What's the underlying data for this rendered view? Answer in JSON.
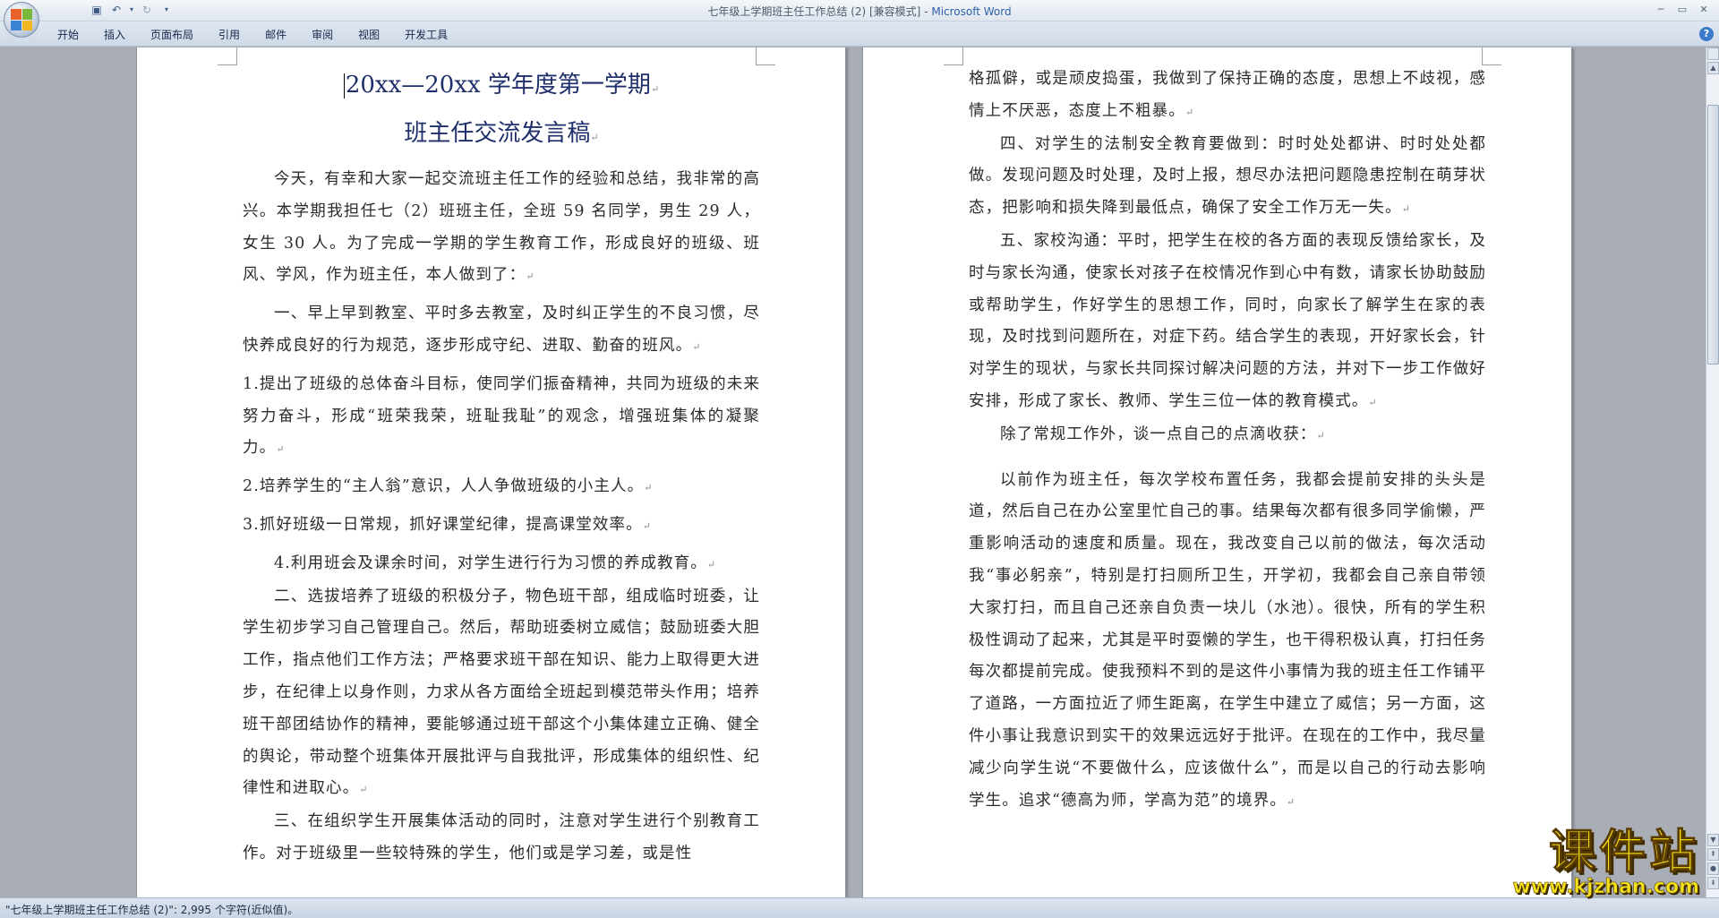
{
  "window": {
    "title": "七年级上学期班主任工作总结 (2) [兼容模式]",
    "title_separator": " - ",
    "app_name": "Microsoft Word"
  },
  "qat": {
    "save_icon": "save-icon",
    "undo_icon": "undo-icon",
    "redo_icon": "redo-icon",
    "customize_icon": "dropdown-icon"
  },
  "ribbon": {
    "tabs": [
      "开始",
      "插入",
      "页面布局",
      "引用",
      "邮件",
      "审阅",
      "视图",
      "开发工具"
    ]
  },
  "document": {
    "title_line1": "20xx—20xx 学年度第一学期",
    "title_line2": "班主任交流发言稿",
    "para_mark": "↵",
    "left_paragraphs": [
      "今天，有幸和大家一起交流班主任工作的经验和总结，我非常的高兴。本学期我担任七（2）班班主任，全班 59 名同学，男生 29 人，女生 30 人。为了完成一学期的学生教育工作，形成良好的班级、班风、学风，作为班主任，本人做到了：",
      "一、早上早到教室、平时多去教室，及时纠正学生的不良习惯，尽快养成良好的行为规范，逐步形成守纪、进取、勤奋的班风。",
      "1.提出了班级的总体奋斗目标，使同学们振奋精神，共同为班级的未来努力奋斗，形成“班荣我荣，班耻我耻”的观念，增强班集体的凝聚力。",
      "2.培养学生的“主人翁”意识，人人争做班级的小主人。",
      "3.抓好班级一日常规，抓好课堂纪律，提高课堂效率。",
      "4.利用班会及课余时间，对学生进行行为习惯的养成教育。",
      "二、选拔培养了班级的积极分子，物色班干部，组成临时班委，让学生初步学习自己管理自己。然后，帮助班委树立威信；鼓励班委大胆工作，指点他们工作方法；严格要求班干部在知识、能力上取得更大进步，在纪律上以身作则，力求从各方面给全班起到模范带头作用；培养班干部团结协作的精神，要能够通过班干部这个小集体建立正确、健全的舆论，带动整个班集体开展批评与自我批评，形成集体的组织性、纪律性和进取心。",
      "三、在组织学生开展集体活动的同时，注意对学生进行个别教育工作。对于班级里一些较特殊的学生，他们或是学习差，或是性"
    ],
    "right_paragraphs": [
      "格孤僻，或是顽皮捣蛋，我做到了保持正确的态度，思想上不歧视，感情上不厌恶，态度上不粗暴。",
      "四、对学生的法制安全教育要做到：时时处处都讲、时时处处都做。发现问题及时处理，及时上报，想尽办法把问题隐患控制在萌芽状态，把影响和损失降到最低点，确保了安全工作万无一失。",
      "五、家校沟通：平时，把学生在校的各方面的表现反馈给家长，及时与家长沟通，使家长对孩子在校情况作到心中有数，请家长协助鼓励或帮助学生，作好学生的思想工作，同时，向家长了解学生在家的表现，及时找到问题所在，对症下药。结合学生的表现，开好家长会，针对学生的现状，与家长共同探讨解决问题的方法，并对下一步工作做好安排，形成了家长、教师、学生三位一体的教育模式。",
      "除了常规工作外，谈一点自己的点滴收获：",
      "以前作为班主任，每次学校布置任务，我都会提前安排的头头是道，然后自己在办公室里忙自己的事。结果每次都有很多同学偷懒，严重影响活动的速度和质量。现在，我改变自己以前的做法，每次活动我“事必躬亲”，特别是打扫厕所卫生，开学初，我都会自己亲自带领大家打扫，而且自己还亲自负责一块儿（水池）。很快，所有的学生积极性调动了起来，尤其是平时耍懒的学生，也干得积极认真，打扫任务每次都提前完成。使我预料不到的是这件小事情为我的班主任工作铺平了道路，一方面拉近了师生距离，在学生中建立了威信；另一方面，这件小事让我意识到实干的效果远远好于批评。在现在的工作中，我尽量减少向学生说“不要做什么，应该做什么”，而是以自己的行动去影响学生。追求“德高为师，学高为范”的境界。"
    ]
  },
  "status": {
    "text": "\"七年级上学期班主任工作总结 (2)\": 2,995 个字符(近似值)。"
  },
  "watermark": {
    "main": "课件站",
    "url": "www.kjzhan.com"
  },
  "colors": {
    "title_text": "#1f2f6b",
    "app_name": "#2f5fa5",
    "watermark": "#f4e21a"
  }
}
